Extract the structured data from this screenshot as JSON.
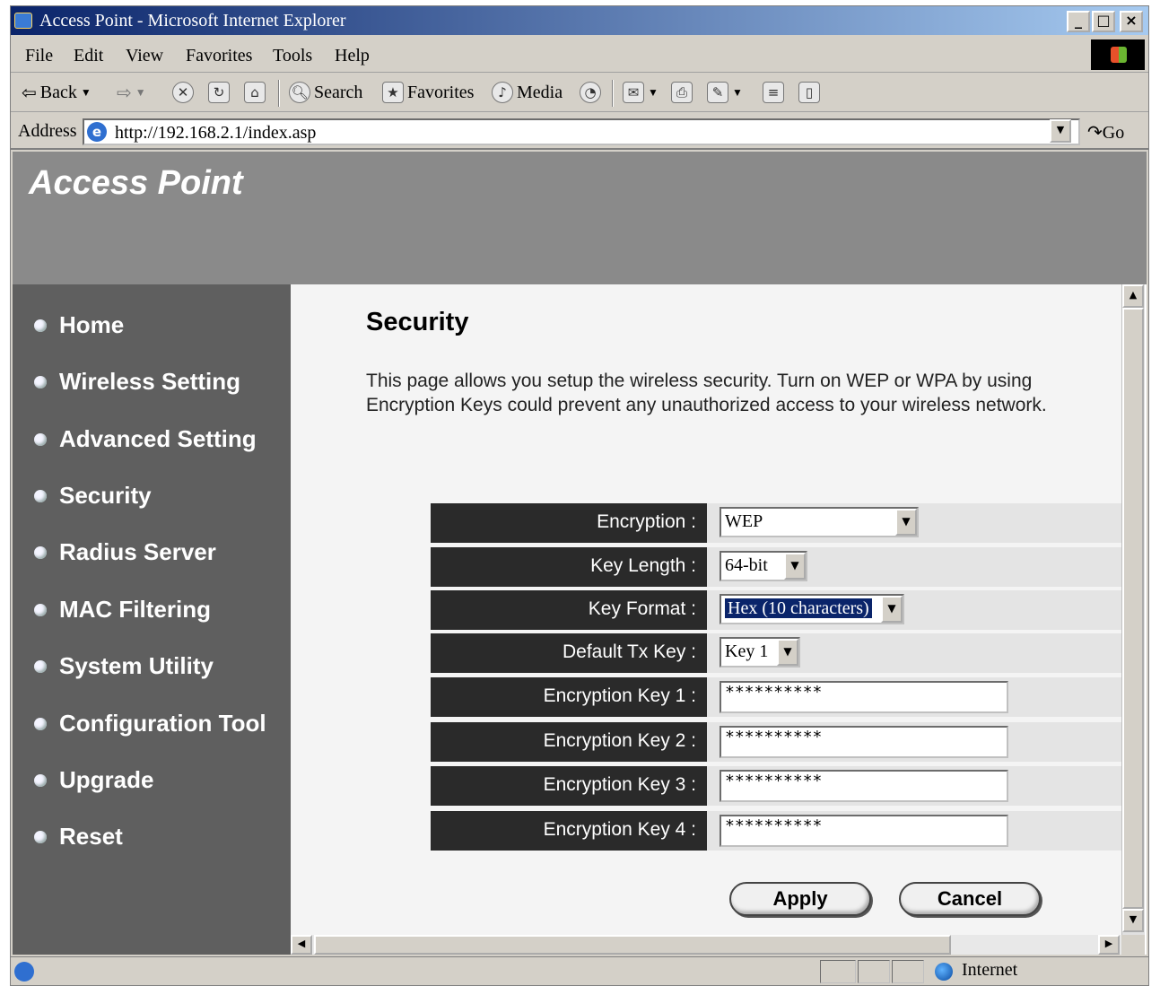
{
  "window": {
    "title": "Access Point - Microsoft Internet Explorer"
  },
  "menu": [
    "File",
    "Edit",
    "View",
    "Favorites",
    "Tools",
    "Help"
  ],
  "toolbar": {
    "back": "Back",
    "search": "Search",
    "favorites": "Favorites",
    "media": "Media"
  },
  "address": {
    "label": "Address",
    "url": "http://192.168.2.1/index.asp",
    "go": "Go"
  },
  "banner": {
    "brand": "Access Point"
  },
  "sidebar": {
    "items": [
      {
        "label": "Home"
      },
      {
        "label": "Wireless Setting"
      },
      {
        "label": "Advanced Setting"
      },
      {
        "label": "Security"
      },
      {
        "label": "Radius Server"
      },
      {
        "label": "MAC Filtering"
      },
      {
        "label": "System Utility"
      },
      {
        "label": "Configuration Tool"
      },
      {
        "label": "Upgrade"
      },
      {
        "label": "Reset"
      }
    ]
  },
  "main": {
    "title": "Security",
    "description": "This page allows you setup the wireless security. Turn on WEP or WPA by using Encryption Keys could prevent any unauthorized access to your wireless network.",
    "fields": {
      "encryption": {
        "label": "Encryption :",
        "value": "WEP"
      },
      "key_length": {
        "label": "Key Length :",
        "value": "64-bit"
      },
      "key_format": {
        "label": "Key Format :",
        "value": "Hex (10 characters)"
      },
      "default_tx_key": {
        "label": "Default Tx Key :",
        "value": "Key 1"
      },
      "key1": {
        "label": "Encryption Key 1 :",
        "value": "**********"
      },
      "key2": {
        "label": "Encryption Key 2 :",
        "value": "**********"
      },
      "key3": {
        "label": "Encryption Key 3 :",
        "value": "**********"
      },
      "key4": {
        "label": "Encryption Key 4 :",
        "value": "**********"
      }
    },
    "apply": "Apply",
    "cancel": "Cancel"
  },
  "status": {
    "zone": "Internet"
  }
}
